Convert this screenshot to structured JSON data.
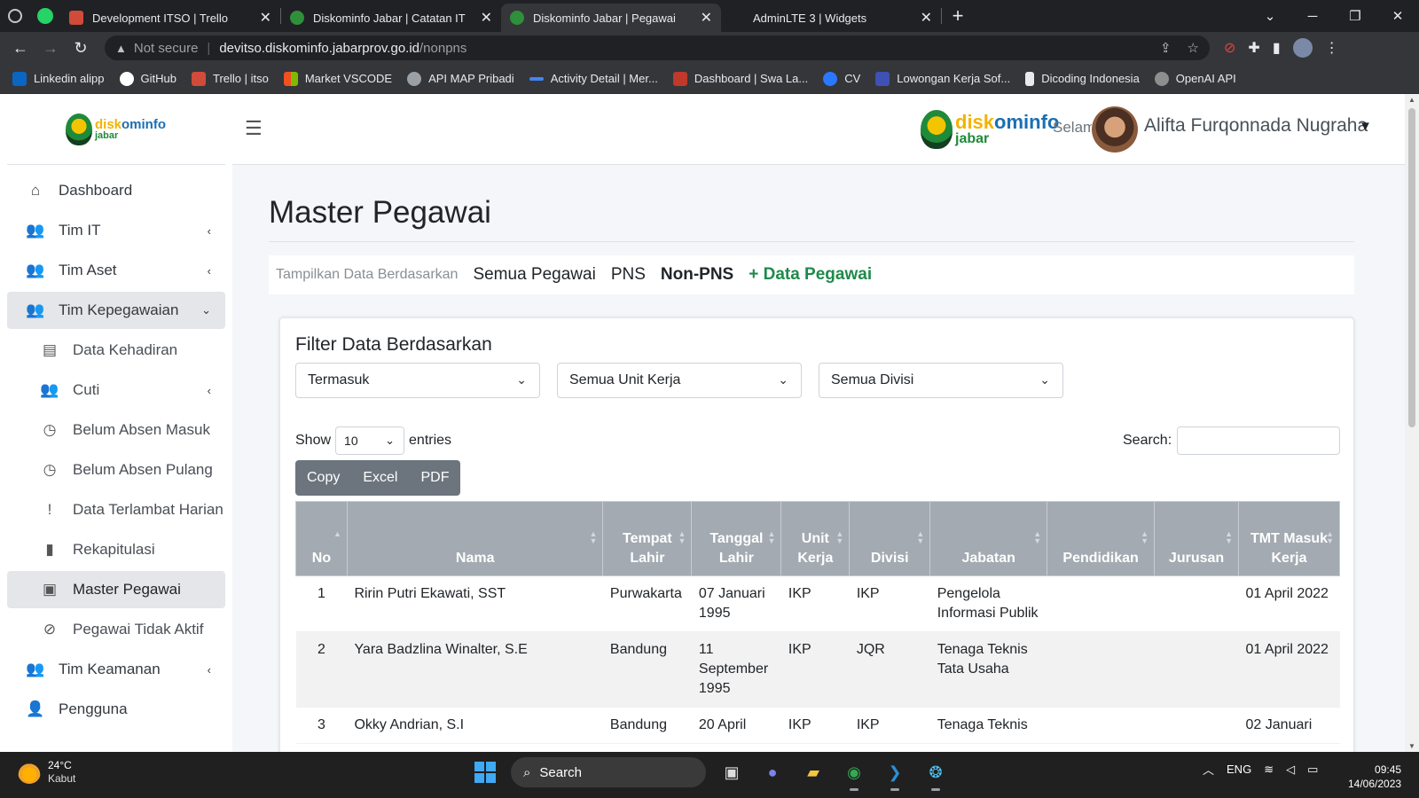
{
  "browser": {
    "tabs": [
      {
        "title": "Development ITSO | Trello",
        "favicon_color": "#d04b3a",
        "active": false
      },
      {
        "title": "Diskominfo Jabar | Catatan IT",
        "favicon_color": "#2f8f3a",
        "active": false
      },
      {
        "title": "Diskominfo Jabar | Pegawai",
        "favicon_color": "#2f8f3a",
        "active": true
      },
      {
        "title": "AdminLTE 3 | Widgets",
        "favicon_color": "#35363a",
        "active": false
      }
    ],
    "address": {
      "security": "Not secure",
      "host": "devitso.diskominfo.jabarprov.go.id",
      "path": "/nonpns"
    },
    "bookmarks": [
      {
        "label": "Linkedin alipp",
        "color": "#0a66c2"
      },
      {
        "label": "GitHub",
        "color": "#ffffff"
      },
      {
        "label": "Trello | itso",
        "color": "#d04b3a"
      },
      {
        "label": "Market VSCODE",
        "color": "#f25022"
      },
      {
        "label": "API MAP Pribadi",
        "color": "#9aa0a6"
      },
      {
        "label": "Activity Detail | Mer...",
        "color": "#4285f4"
      },
      {
        "label": "Dashboard | Swa La...",
        "color": "#c0392b"
      },
      {
        "label": "CV",
        "color": "#2979ff"
      },
      {
        "label": "Lowongan Kerja Sof...",
        "color": "#3f51b5"
      },
      {
        "label": "Dicoding Indonesia",
        "color": "#e8eaed"
      },
      {
        "label": "OpenAI API",
        "color": "#8e8e8e"
      }
    ]
  },
  "brand": {
    "logo_part1": "disk",
    "logo_part2": "ominfo",
    "logo_sub": "jabar"
  },
  "topnav": {
    "greeting": "Selamat",
    "user_name": "Alifta Furqonnada Nugraha"
  },
  "sidebar": {
    "items": [
      {
        "label": "Dashboard",
        "icon": "home-icon",
        "glyph": "⌂",
        "level": 0,
        "chevron": ""
      },
      {
        "label": "Tim IT",
        "icon": "users-icon",
        "glyph": "👥",
        "level": 0,
        "chevron": "‹"
      },
      {
        "label": "Tim Aset",
        "icon": "users-icon",
        "glyph": "👥",
        "level": 0,
        "chevron": "‹"
      },
      {
        "label": "Tim Kepegawaian",
        "icon": "users-icon",
        "glyph": "👥",
        "level": 0,
        "chevron": "⌄",
        "open": true
      },
      {
        "label": "Data Kehadiran",
        "icon": "clipboard-icon",
        "glyph": "▤",
        "level": 1,
        "chevron": ""
      },
      {
        "label": "Cuti",
        "icon": "users-icon",
        "glyph": "👥",
        "level": 1,
        "chevron": "‹"
      },
      {
        "label": "Belum Absen Masuk",
        "icon": "clock-icon",
        "glyph": "◷",
        "level": 1,
        "chevron": ""
      },
      {
        "label": "Belum Absen Pulang",
        "icon": "clock-icon",
        "glyph": "◷",
        "level": 1,
        "chevron": ""
      },
      {
        "label": "Data Terlambat Harian",
        "icon": "exclamation-icon",
        "glyph": "!",
        "level": 1,
        "chevron": ""
      },
      {
        "label": "Rekapitulasi",
        "icon": "file-icon",
        "glyph": "▮",
        "level": 1,
        "chevron": ""
      },
      {
        "label": "Master Pegawai",
        "icon": "id-card-icon",
        "glyph": "▣",
        "level": 1,
        "chevron": "",
        "current": true
      },
      {
        "label": "Pegawai Tidak Aktif",
        "icon": "user-slash-icon",
        "glyph": "⊘",
        "level": 1,
        "chevron": ""
      },
      {
        "label": "Tim Keamanan",
        "icon": "users-icon",
        "glyph": "👥",
        "level": 0,
        "chevron": "‹"
      },
      {
        "label": "Pengguna",
        "icon": "user-plus-icon",
        "glyph": "👤",
        "level": 0,
        "chevron": ""
      }
    ]
  },
  "main": {
    "title": "Master Pegawai",
    "filterbar": {
      "label": "Tampilkan Data Berdasarkan",
      "links": [
        "Semua Pegawai",
        "PNS",
        "Non-PNS"
      ],
      "active_link": "Non-PNS",
      "add_label": "+ Data Pegawai"
    },
    "filter_card": {
      "title": "Filter Data Berdasarkan",
      "selects": [
        "Termasuk",
        "Semua Unit Kerja",
        "Semua Divisi"
      ]
    },
    "table_controls": {
      "show_label": "Show",
      "entries_value": "10",
      "entries_label": "entries",
      "search_label": "Search:",
      "buttons": [
        "Copy",
        "Excel",
        "PDF"
      ]
    },
    "table": {
      "headers": [
        "No",
        "Nama",
        "Tempat Lahir",
        "Tanggal Lahir",
        "Unit Kerja",
        "Divisi",
        "Jabatan",
        "Pendidikan",
        "Jurusan",
        "TMT Masuk Kerja"
      ],
      "rows": [
        [
          "1",
          "Ririn Putri Ekawati, SST",
          "Purwakarta",
          "07 Januari 1995",
          "IKP",
          "IKP",
          "Pengelola Informasi Publik",
          "",
          "",
          "01 April 2022"
        ],
        [
          "2",
          "Yara Badzlina Winalter, S.E",
          "Bandung",
          "11 September 1995",
          "IKP",
          "JQR",
          "Tenaga Teknis Tata Usaha",
          "",
          "",
          "01 April 2022"
        ],
        [
          "3",
          "Okky Andrian, S.I",
          "Bandung",
          "20 April",
          "IKP",
          "IKP",
          "Tenaga Teknis",
          "",
          "",
          "02 Januari"
        ]
      ]
    }
  },
  "taskbar": {
    "weather_temp": "24°C",
    "weather_desc": "Kabut",
    "search_label": "Search",
    "lang": "ENG",
    "time": "09:45",
    "date": "14/06/2023"
  }
}
